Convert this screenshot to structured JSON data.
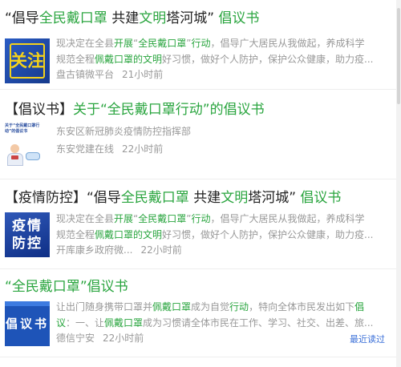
{
  "items": [
    {
      "title_parts": [
        {
          "t": "“倡导",
          "c": "dk"
        },
        {
          "t": "全民戴口罩",
          "c": "hl"
        },
        {
          "t": " 共建",
          "c": "dk"
        },
        {
          "t": "文明",
          "c": "hl"
        },
        {
          "t": "塔河城”",
          "c": "dk"
        },
        {
          "t": " 倡议书",
          "c": "hl"
        }
      ],
      "thumb_text": "关注",
      "snippet_lines": [
        [
          {
            "t": "现决定在全县",
            "c": ""
          },
          {
            "t": "开展",
            "c": "hl"
          },
          {
            "t": "“",
            "c": ""
          },
          {
            "t": "全民戴口罩",
            "c": "hl"
          },
          {
            "t": "”",
            "c": ""
          },
          {
            "t": "行动",
            "c": "hl"
          },
          {
            "t": "，倡导广大居民从我做起，养成科学",
            "c": ""
          }
        ],
        [
          {
            "t": "规范全程",
            "c": ""
          },
          {
            "t": "佩戴口罩的文明",
            "c": "hl"
          },
          {
            "t": "好习惯，做好个人防护，保护公众健康，助力疫...",
            "c": ""
          }
        ]
      ],
      "source": "盘古镇微平台",
      "time": "21小时前"
    },
    {
      "title_parts": [
        {
          "t": "【倡议书】",
          "c": "dk"
        },
        {
          "t": "关于“全民戴口罩行动”的倡议书",
          "c": "hl"
        }
      ],
      "thumb_caption": "关于“全民戴口罩行动”的倡议书",
      "snippet_lines": [
        [
          {
            "t": "东安区新冠肺炎疫情防控指挥部",
            "c": ""
          }
        ]
      ],
      "source": "东安党建在线",
      "time": "22小时前"
    },
    {
      "title_parts": [
        {
          "t": "【疫情防控】“倡导",
          "c": "dk"
        },
        {
          "t": "全民戴口罩",
          "c": "hl"
        },
        {
          "t": " 共建",
          "c": "dk"
        },
        {
          "t": "文明",
          "c": "hl"
        },
        {
          "t": "塔河城”",
          "c": "dk"
        },
        {
          "t": " 倡议书",
          "c": "hl"
        }
      ],
      "thumb_text": "疫情防控",
      "snippet_lines": [
        [
          {
            "t": "现决定在全县",
            "c": ""
          },
          {
            "t": "开展",
            "c": "hl"
          },
          {
            "t": "“",
            "c": ""
          },
          {
            "t": "全民戴口罩",
            "c": "hl"
          },
          {
            "t": "”",
            "c": ""
          },
          {
            "t": "行动",
            "c": "hl"
          },
          {
            "t": "，倡导广大居民从我做起，养成科学",
            "c": ""
          }
        ],
        [
          {
            "t": "规范全程",
            "c": ""
          },
          {
            "t": "佩戴口罩的文明",
            "c": "hl"
          },
          {
            "t": "好习惯，做好个人防护，保护公众健康，助力疫...",
            "c": ""
          }
        ]
      ],
      "source": "开库康乡政府微...",
      "time": "22小时前"
    },
    {
      "title_parts": [
        {
          "t": "“",
          "c": "hl"
        },
        {
          "t": "全民戴口罩",
          "c": "hl"
        },
        {
          "t": "”",
          "c": "hl"
        },
        {
          "t": "倡议书",
          "c": "hl"
        }
      ],
      "thumb_text": "倡议书",
      "snippet_lines": [
        [
          {
            "t": "让出门随身携带口罩并",
            "c": ""
          },
          {
            "t": "佩戴口罩",
            "c": "hl"
          },
          {
            "t": "成为自觉",
            "c": ""
          },
          {
            "t": "行动",
            "c": "hl"
          },
          {
            "t": "，特向全体市民发出如下",
            "c": ""
          },
          {
            "t": "倡",
            "c": "hl"
          }
        ],
        [
          {
            "t": "议",
            "c": "hl"
          },
          {
            "t": "：一、让",
            "c": ""
          },
          {
            "t": "佩戴口罩",
            "c": "hl"
          },
          {
            "t": "成为习惯请全体市民在工作、学习、社交、出差、旅...",
            "c": ""
          }
        ]
      ],
      "source": "德信宁安",
      "time": "22小时前",
      "recent_label": "最近读过"
    }
  ],
  "colors": {
    "highlight": "#2aa53f",
    "muted": "#999999",
    "link": "#3a6fd8"
  }
}
